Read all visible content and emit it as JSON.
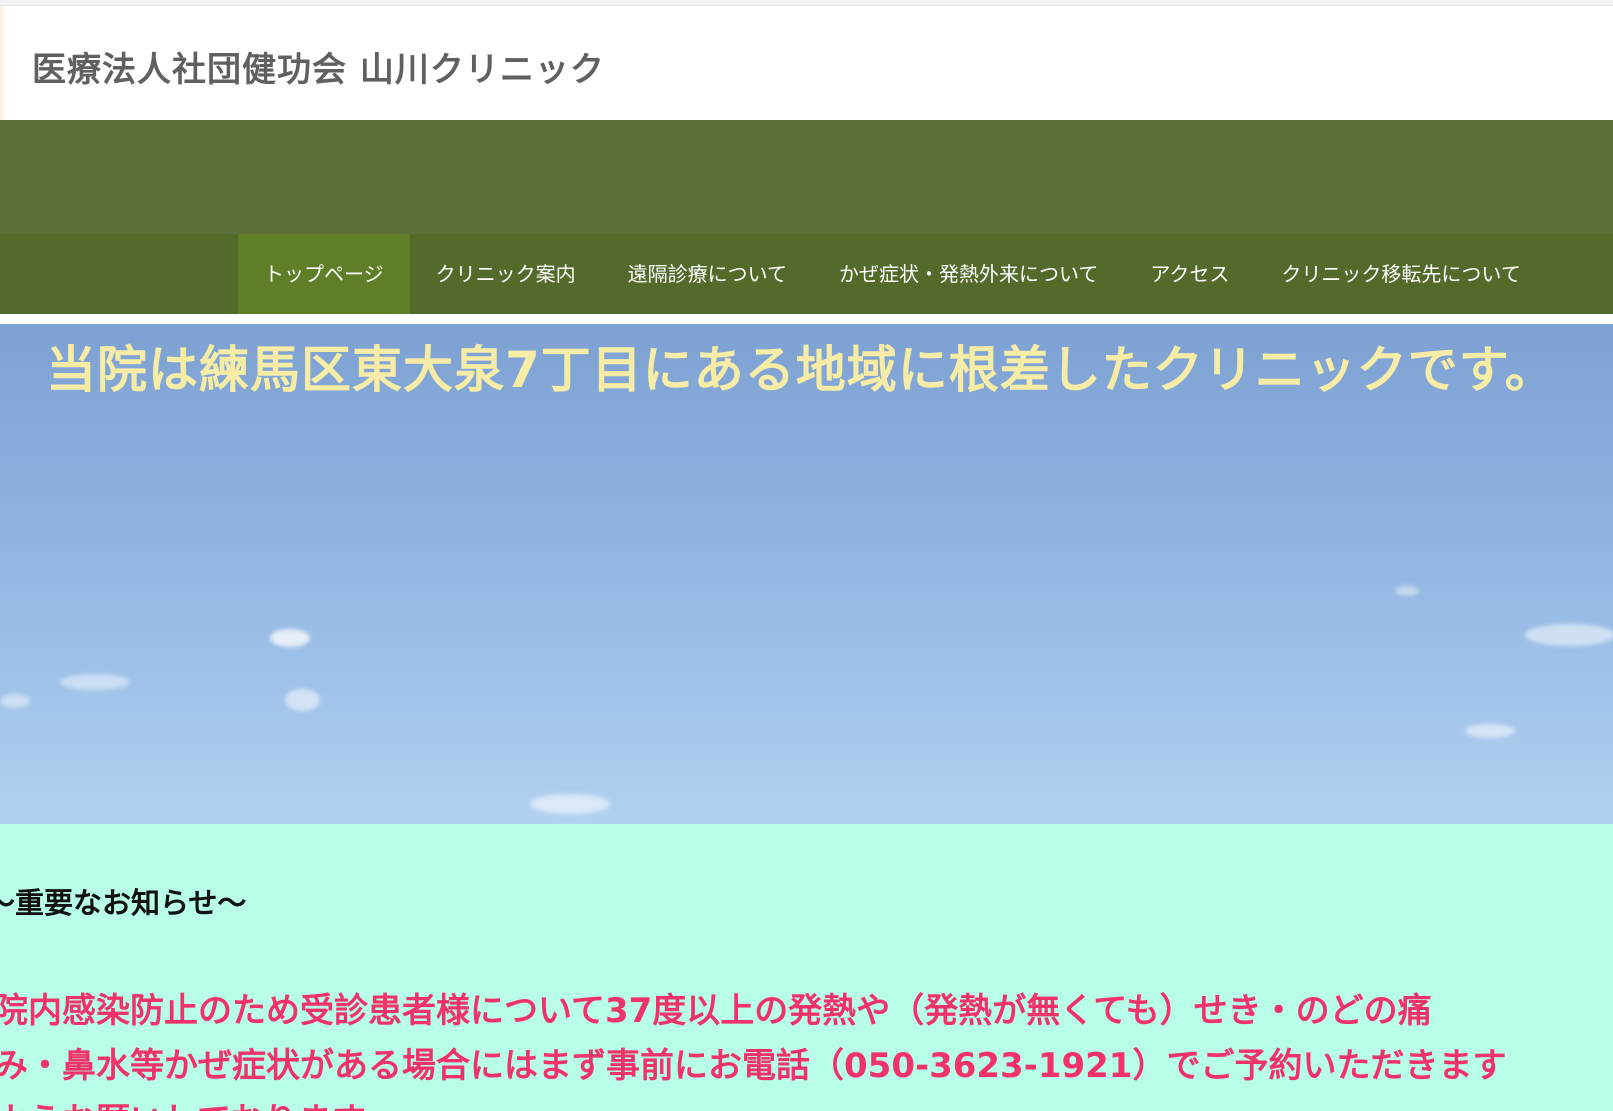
{
  "header": {
    "site_title": "医療法人社団健功会 山川クリニック"
  },
  "nav": {
    "items": [
      {
        "label": "トップページ",
        "active": true
      },
      {
        "label": "クリニック案内",
        "active": false
      },
      {
        "label": "遠隔診療について",
        "active": false
      },
      {
        "label": "かぜ症状・発熱外来について",
        "active": false
      },
      {
        "label": "アクセス",
        "active": false
      },
      {
        "label": "クリニック移転先について",
        "active": false
      }
    ]
  },
  "hero": {
    "headline": "当院は練馬区東大泉7丁目にある地域に根差したクリニックです。"
  },
  "notice": {
    "heading": "～重要なお知らせ～",
    "lines": [
      "院内感染防止のため受診患者様について37度以上の発熱や（発熱が無くても）せき・のどの痛",
      "み・鼻水等かぜ症状がある場合にはまず事前にお電話（050-3623-1921）でご予約いただきます",
      "ようお願いしております。"
    ]
  },
  "colors": {
    "title_text": "#606060",
    "green_band": "#5b7038",
    "nav_bg": "#536a2a",
    "nav_active": "#5e7f28",
    "hero_headline": "#f7eca6",
    "notice_bg": "#b8fde8",
    "notice_text": "#f0326a"
  }
}
